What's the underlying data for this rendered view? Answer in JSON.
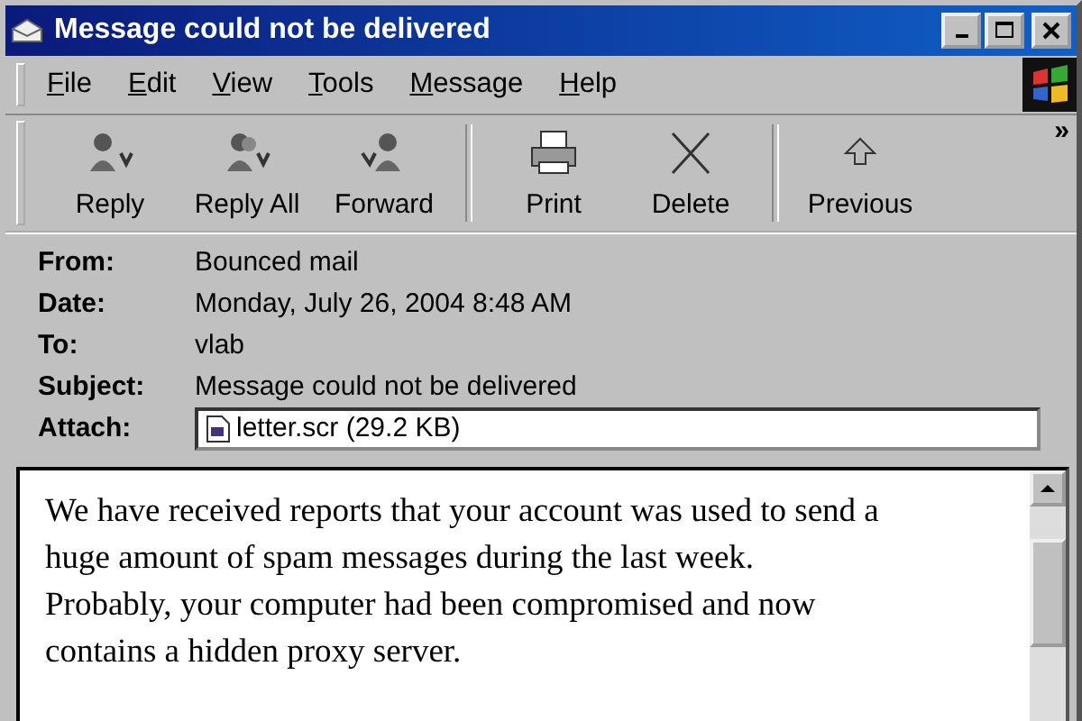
{
  "window": {
    "title": "Message could not be delivered"
  },
  "menu": [
    "File",
    "Edit",
    "View",
    "Tools",
    "Message",
    "Help"
  ],
  "toolbar": {
    "groups": [
      [
        {
          "label": "Reply",
          "kind": "reply"
        },
        {
          "label": "Reply All",
          "kind": "replyall"
        },
        {
          "label": "Forward",
          "kind": "forward"
        }
      ],
      [
        {
          "label": "Print",
          "kind": "print"
        },
        {
          "label": "Delete",
          "kind": "delete"
        }
      ],
      [
        {
          "label": "Previous",
          "kind": "previous"
        }
      ]
    ],
    "overflow": "»"
  },
  "header": [
    {
      "label": "From:",
      "value": "Bounced mail"
    },
    {
      "label": "Date:",
      "value": "Monday, July 26, 2004 8:48 AM"
    },
    {
      "label": "To:",
      "value": "vlab"
    },
    {
      "label": "Subject:",
      "value": "Message could not be delivered"
    }
  ],
  "attach": {
    "label": "Attach:",
    "file": "letter.scr (29.2 KB)"
  },
  "body": [
    "We have received reports that your account was used to send a huge amount of spam messages during the last week.",
    "Probably, your computer had been compromised and now contains a hidden proxy server."
  ]
}
